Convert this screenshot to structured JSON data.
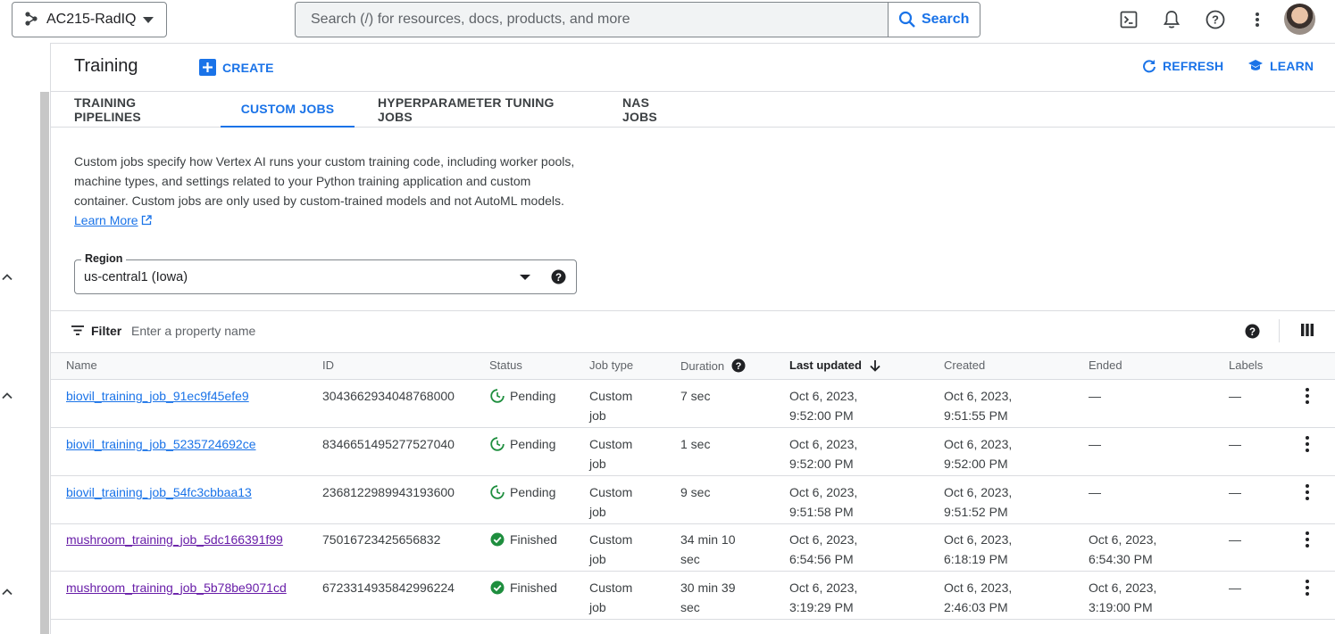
{
  "topbar": {
    "project": "AC215-RadIQ",
    "search_placeholder": "Search (/) for resources, docs, products, and more",
    "search_button": "Search"
  },
  "header": {
    "title": "Training",
    "create": "CREATE",
    "refresh": "REFRESH",
    "learn": "LEARN"
  },
  "tabs": [
    "TRAINING PIPELINES",
    "CUSTOM JOBS",
    "HYPERPARAMETER TUNING JOBS",
    "NAS JOBS"
  ],
  "active_tab": "CUSTOM JOBS",
  "description": {
    "text": "Custom jobs specify how Vertex AI runs your custom training code, including worker pools, machine types, and settings related to your Python training application and custom container. Custom jobs are only used by custom-trained models and not AutoML models.",
    "link": "Learn More"
  },
  "region": {
    "label": "Region",
    "value": "us-central1 (Iowa)"
  },
  "filter": {
    "label": "Filter",
    "placeholder": "Enter a property name"
  },
  "table": {
    "columns": {
      "name": "Name",
      "id": "ID",
      "status": "Status",
      "job_type": "Job type",
      "duration": "Duration",
      "last_updated": "Last updated",
      "created": "Created",
      "ended": "Ended",
      "labels": "Labels"
    },
    "rows": [
      {
        "name": "biovil_training_job_91ec9f45efe9",
        "id": "3043662934048768000",
        "status": "Pending",
        "job_type": "Custom\njob",
        "duration": "7 sec",
        "last_updated": "Oct 6, 2023,\n9:52:00 PM",
        "created": "Oct 6, 2023,\n9:51:55 PM",
        "ended": "—",
        "labels": "—"
      },
      {
        "name": "biovil_training_job_5235724692ce",
        "id": "8346651495277527040",
        "status": "Pending",
        "job_type": "Custom\njob",
        "duration": "1 sec",
        "last_updated": "Oct 6, 2023,\n9:52:00 PM",
        "created": "Oct 6, 2023,\n9:52:00 PM",
        "ended": "—",
        "labels": "—"
      },
      {
        "name": "biovil_training_job_54fc3cbbaa13",
        "id": "2368122989943193600",
        "status": "Pending",
        "job_type": "Custom\njob",
        "duration": "9 sec",
        "last_updated": "Oct 6, 2023,\n9:51:58 PM",
        "created": "Oct 6, 2023,\n9:51:52 PM",
        "ended": "—",
        "labels": "—"
      },
      {
        "name": "mushroom_training_job_5dc166391f99",
        "id": "75016723425656832",
        "status": "Finished",
        "job_type": "Custom\njob",
        "duration": "34 min 10\nsec",
        "last_updated": "Oct 6, 2023,\n6:54:56 PM",
        "created": "Oct 6, 2023,\n6:18:19 PM",
        "ended": "Oct 6, 2023,\n6:54:30 PM",
        "labels": "—"
      },
      {
        "name": "mushroom_training_job_5b78be9071cd",
        "id": "6723314935842996224",
        "status": "Finished",
        "job_type": "Custom\njob",
        "duration": "30 min 39\nsec",
        "last_updated": "Oct 6, 2023,\n3:19:29 PM",
        "created": "Oct 6, 2023,\n2:46:03 PM",
        "ended": "Oct 6, 2023,\n3:19:00 PM",
        "labels": "—"
      }
    ]
  },
  "icons": {
    "project": "project-nodes-icon",
    "search": "search-icon",
    "terminal": "cloud-shell-icon",
    "bell": "notifications-icon",
    "help": "help-icon",
    "more": "more-vert-icon",
    "pending": "pending-icon",
    "finished": "check-circle-icon"
  },
  "colors": {
    "accent": "#1a73e8",
    "visited_link": "#681da8",
    "success": "#1e8e3e",
    "pending": "#1e8e3e"
  }
}
